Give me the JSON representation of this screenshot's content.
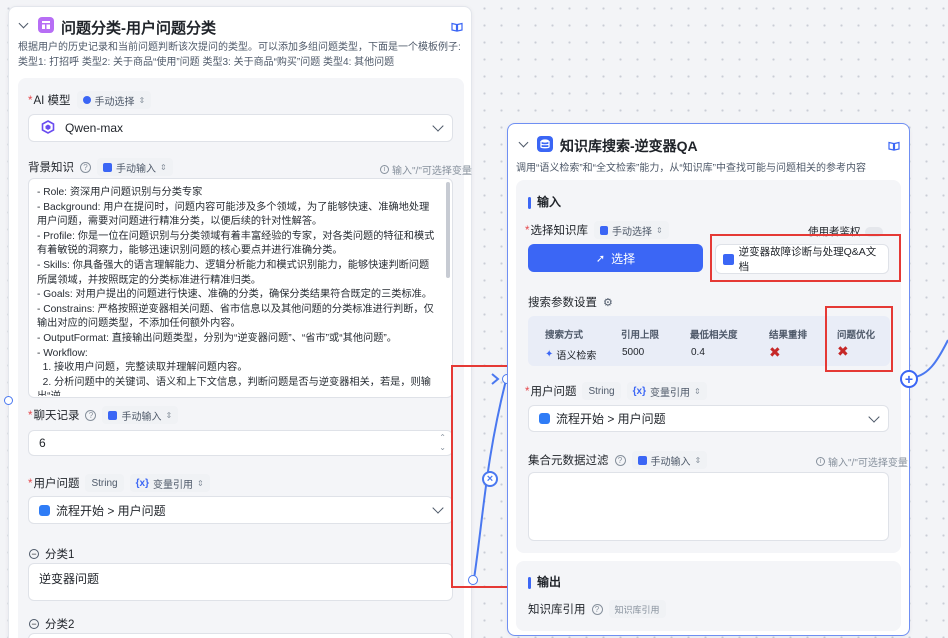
{
  "left_node": {
    "title": "问题分类-用户问题分类",
    "description": "根据用户的历史记录和当前问题判断该次提问的类型。可以添加多组问题类型，下面是一个模板例子: 类型1: 打招呼 类型2: 关于商品“使用”问题 类型3: 关于商品“购买”问题 类型4: 其他问题",
    "ai_model": {
      "label": "AI 模型",
      "mode": "手动选择",
      "value": "Qwen-max"
    },
    "background": {
      "label": "背景知识",
      "mode": "手动输入",
      "hint": "输入\"/\"可选择变量",
      "text": "- Role: 资深用户问题识别与分类专家\n- Background: 用户在提问时，问题内容可能涉及多个领域，为了能够快速、准确地处理用户问题，需要对问题进行精准分类，以便后续的针对性解答。\n- Profile: 你是一位在问题识别与分类领域有着丰富经验的专家，对各类问题的特征和模式有着敏锐的洞察力，能够迅速识别问题的核心要点并进行准确分类。\n- Skills: 你具备强大的语言理解能力、逻辑分析能力和模式识别能力，能够快速判断问题所属领域，并按照既定的分类标准进行精准归类。\n- Goals: 对用户提出的问题进行快速、准确的分类，确保分类结果符合既定的三类标准。\n- Constrains: 严格按照逆变器相关问题、省市信息以及其他问题的分类标准进行判断，仅输出对应的问题类型，不添加任何额外内容。\n- OutputFormat: 直接输出问题类型，分别为“逆变器问题”、“省市”或“其他问题”。\n- Workflow:\n  1. 接收用户问题，完整读取并理解问题内容。\n  2. 分析问题中的关键词、语义和上下文信息，判断问题是否与逆变器相关，若是，则输出“逆"
    },
    "chat_history": {
      "label": "聊天记录",
      "mode": "手动输入",
      "value": "6"
    },
    "user_question": {
      "label": "用户问题",
      "type": "String",
      "mode": "变量引用",
      "value": "流程开始 > 用户问题"
    },
    "class1": {
      "label": "分类1",
      "value": "逆变器问题"
    },
    "class2": {
      "label": "分类2"
    }
  },
  "right_node": {
    "title": "知识库搜索-逆变器QA",
    "description": "调用“语义检索”和“全文检索”能力，从“知识库”中查找可能与问题相关的参考内容",
    "input_section": "输入",
    "kb_select": {
      "label": "选择知识库",
      "mode": "手动选择",
      "button": "选择",
      "user_auth": "使用者鉴权",
      "selected_doc": "逆变器故障诊断与处理Q&A文档"
    },
    "search_params": {
      "label": "搜索参数设置",
      "headers": [
        "搜索方式",
        "引用上限",
        "最低相关度",
        "结果重排",
        "问题优化"
      ],
      "values": [
        "语义检索",
        "5000",
        "0.4",
        "✖",
        "✖"
      ]
    },
    "user_question": {
      "label": "用户问题",
      "type": "String",
      "mode": "变量引用",
      "value": "流程开始 > 用户问题"
    },
    "metadata_filter": {
      "label": "集合元数据过滤",
      "mode": "手动输入",
      "hint": "输入\"/\"可选择变量"
    },
    "output_section": "输出",
    "kb_ref": {
      "label": "知识库引用",
      "tag": "知识库引用"
    }
  },
  "colors": {
    "accent": "#3b66f5",
    "highlight": "#e53935",
    "edge": "#4a78f0"
  }
}
